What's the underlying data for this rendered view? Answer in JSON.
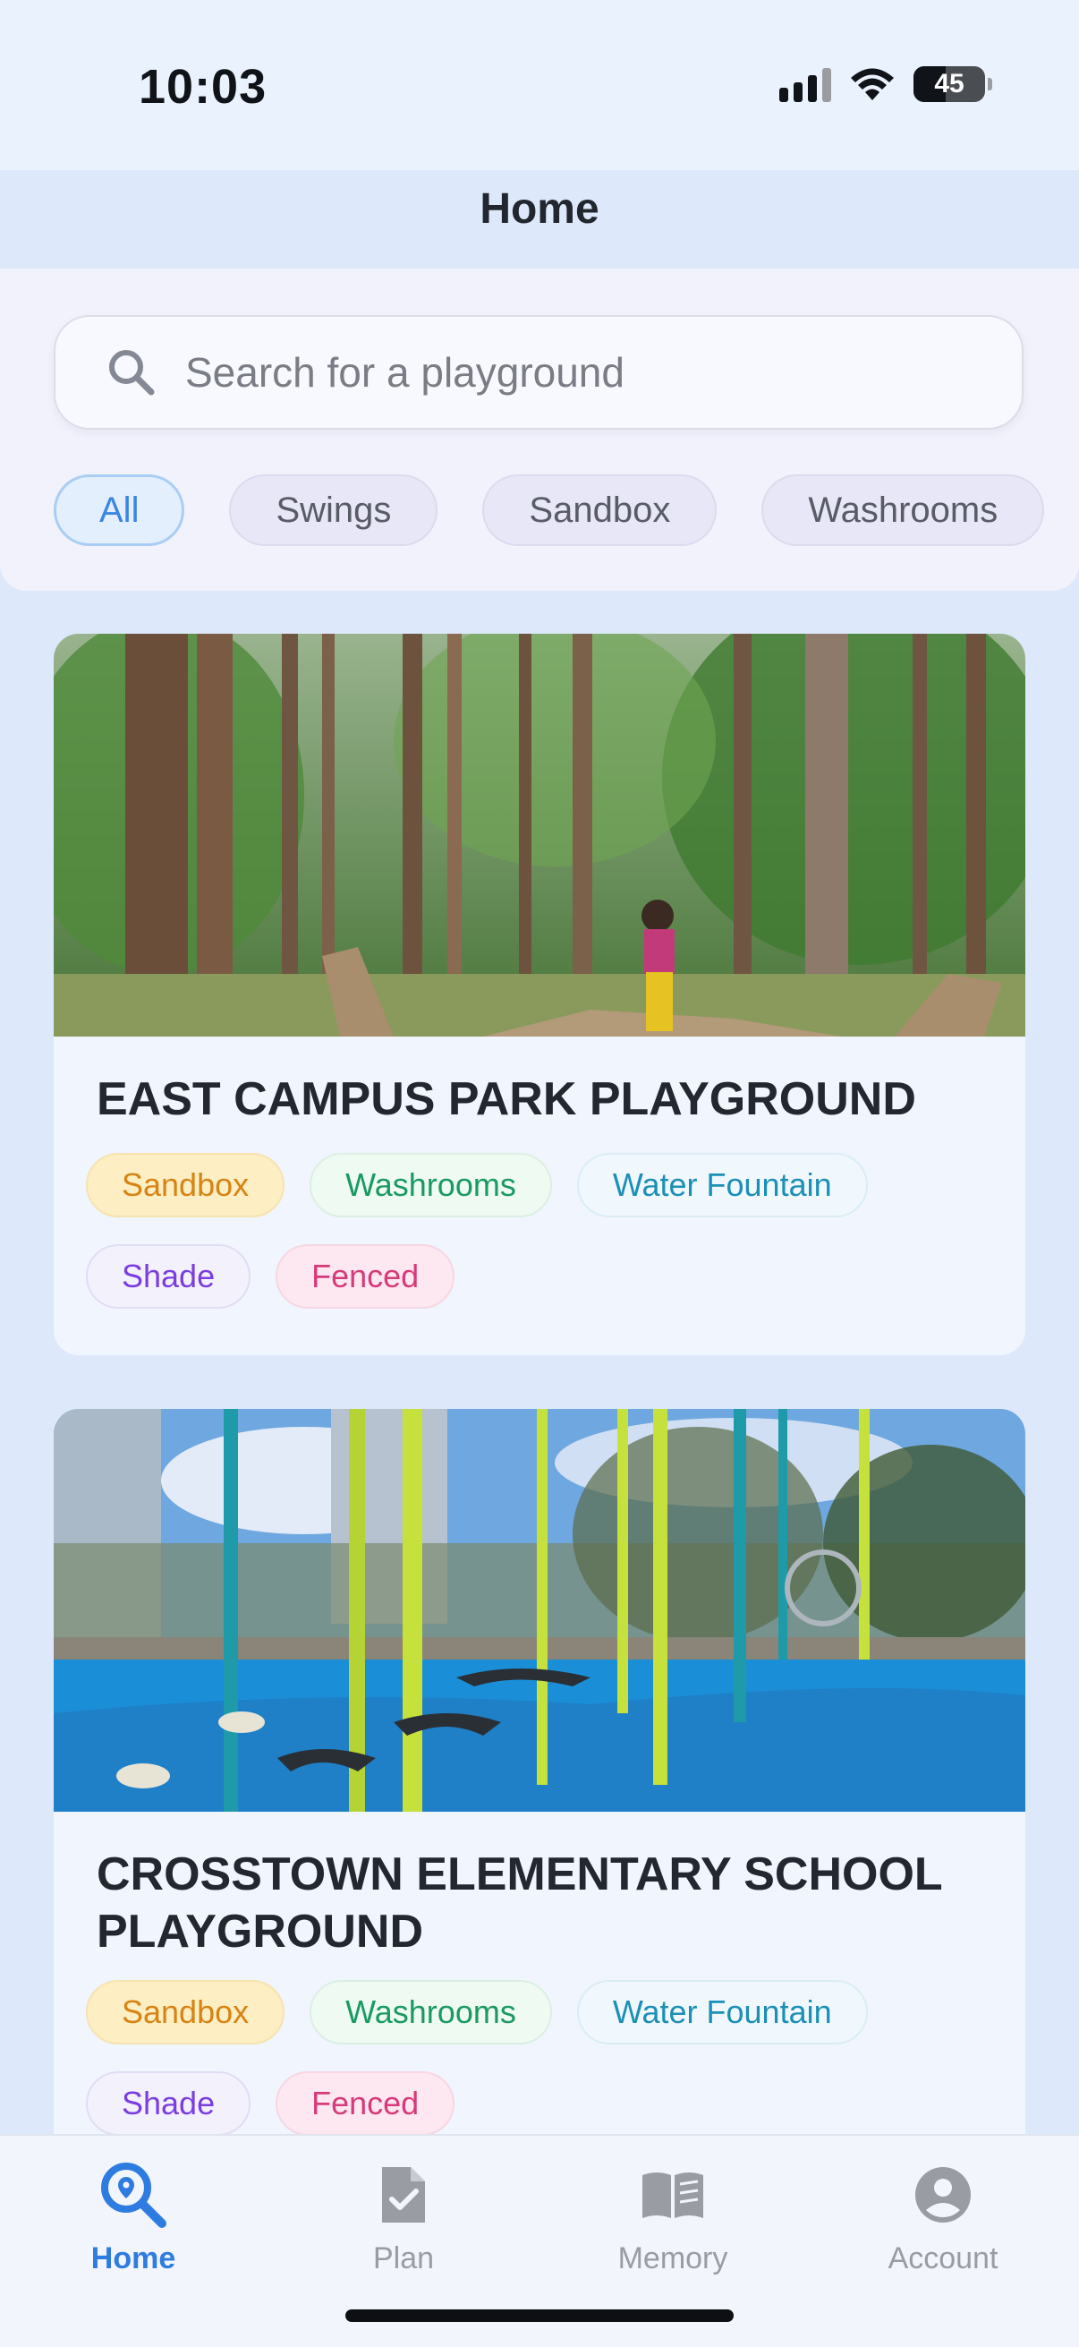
{
  "status_bar": {
    "time": "10:03",
    "battery": "45"
  },
  "header": {
    "title": "Home"
  },
  "search": {
    "placeholder": "Search for a playground"
  },
  "filters": [
    {
      "label": "All",
      "active": true
    },
    {
      "label": "Swings",
      "active": false
    },
    {
      "label": "Sandbox",
      "active": false
    },
    {
      "label": "Washrooms",
      "active": false
    }
  ],
  "playgrounds": [
    {
      "name": "EAST CAMPUS PARK PLAYGROUND",
      "tags": [
        "Sandbox",
        "Washrooms",
        "Water Fountain",
        "Shade",
        "Fenced"
      ]
    },
    {
      "name": "CROSSTOWN ELEMENTARY SCHOOL PLAYGROUND",
      "tags": [
        "Sandbox",
        "Washrooms",
        "Water Fountain",
        "Shade",
        "Fenced"
      ]
    }
  ],
  "tab_bar": {
    "items": [
      {
        "label": "Home",
        "icon": "map-search-icon",
        "active": true
      },
      {
        "label": "Plan",
        "icon": "checklist-icon",
        "active": false
      },
      {
        "label": "Memory",
        "icon": "book-icon",
        "active": false
      },
      {
        "label": "Account",
        "icon": "account-icon",
        "active": false
      }
    ]
  },
  "colors": {
    "accent": "#2f7ce0",
    "background": "#dde9fb",
    "sandbox": "#d68414",
    "washrooms": "#1a9a62",
    "water_fountain": "#1b8fb5",
    "shade": "#7a3ee0",
    "fenced": "#d63a7a"
  }
}
